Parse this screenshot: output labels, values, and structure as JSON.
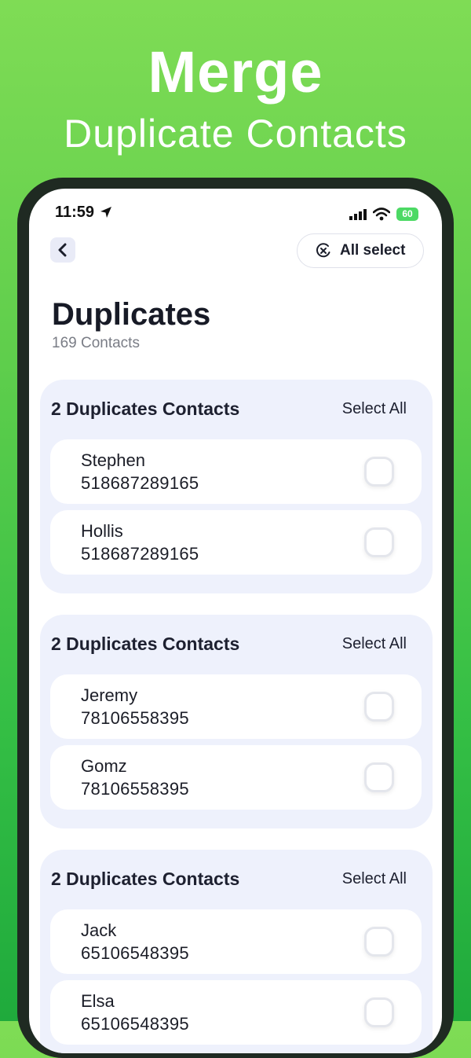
{
  "hero": {
    "title": "Merge",
    "subtitle": "Duplicate Contacts"
  },
  "status_bar": {
    "time": "11:59",
    "battery": "60"
  },
  "nav": {
    "back_icon": "chevron-left-icon",
    "all_select_label": "All select",
    "all_select_icon": "close-circle-icon"
  },
  "page": {
    "title": "Duplicates",
    "count": "169 Contacts"
  },
  "groups": [
    {
      "title": "2 Duplicates Contacts",
      "select_all": "Select All",
      "contacts": [
        {
          "name": "Stephen",
          "phone": "518687289165"
        },
        {
          "name": "Hollis",
          "phone": "518687289165"
        }
      ]
    },
    {
      "title": "2 Duplicates Contacts",
      "select_all": "Select All",
      "contacts": [
        {
          "name": "Jeremy",
          "phone": "78106558395"
        },
        {
          "name": "Gomz",
          "phone": "78106558395"
        }
      ]
    },
    {
      "title": "2 Duplicates Contacts",
      "select_all": "Select All",
      "contacts": [
        {
          "name": "Jack",
          "phone": "65106548395"
        },
        {
          "name": "Elsa",
          "phone": "65106548395"
        }
      ]
    }
  ],
  "colors": {
    "background_green": "#5fce4c",
    "group_bg": "#eef1fc",
    "battery_green": "#4cd964"
  }
}
